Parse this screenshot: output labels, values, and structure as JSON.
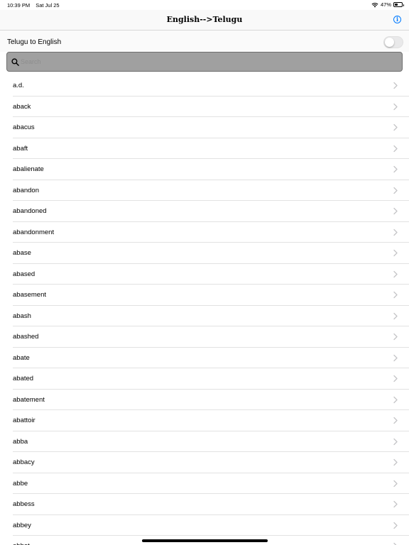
{
  "status_bar": {
    "time": "10:39 PM",
    "date": "Sat Jul 25",
    "battery_percent": "47%",
    "battery_level": 0.47
  },
  "nav": {
    "title": "English-->Telugu",
    "info_icon": "info-icon"
  },
  "toggle_row": {
    "label": "Telugu to English",
    "enabled": false
  },
  "search": {
    "placeholder": "Search",
    "value": ""
  },
  "words": [
    "a.d.",
    "aback",
    "abacus",
    "abaft",
    "abalienate",
    "abandon",
    "abandoned",
    "abandonment",
    "abase",
    "abased",
    "abasement",
    "abash",
    "abashed",
    "abate",
    "abated",
    "abatement",
    "abattoir",
    "abba",
    "abbacy",
    "abbe",
    "abbess",
    "abbey",
    "abbot"
  ],
  "colors": {
    "accent": "#007aff",
    "search_bg": "#a0a0a0",
    "separator": "#e2e2e2"
  }
}
